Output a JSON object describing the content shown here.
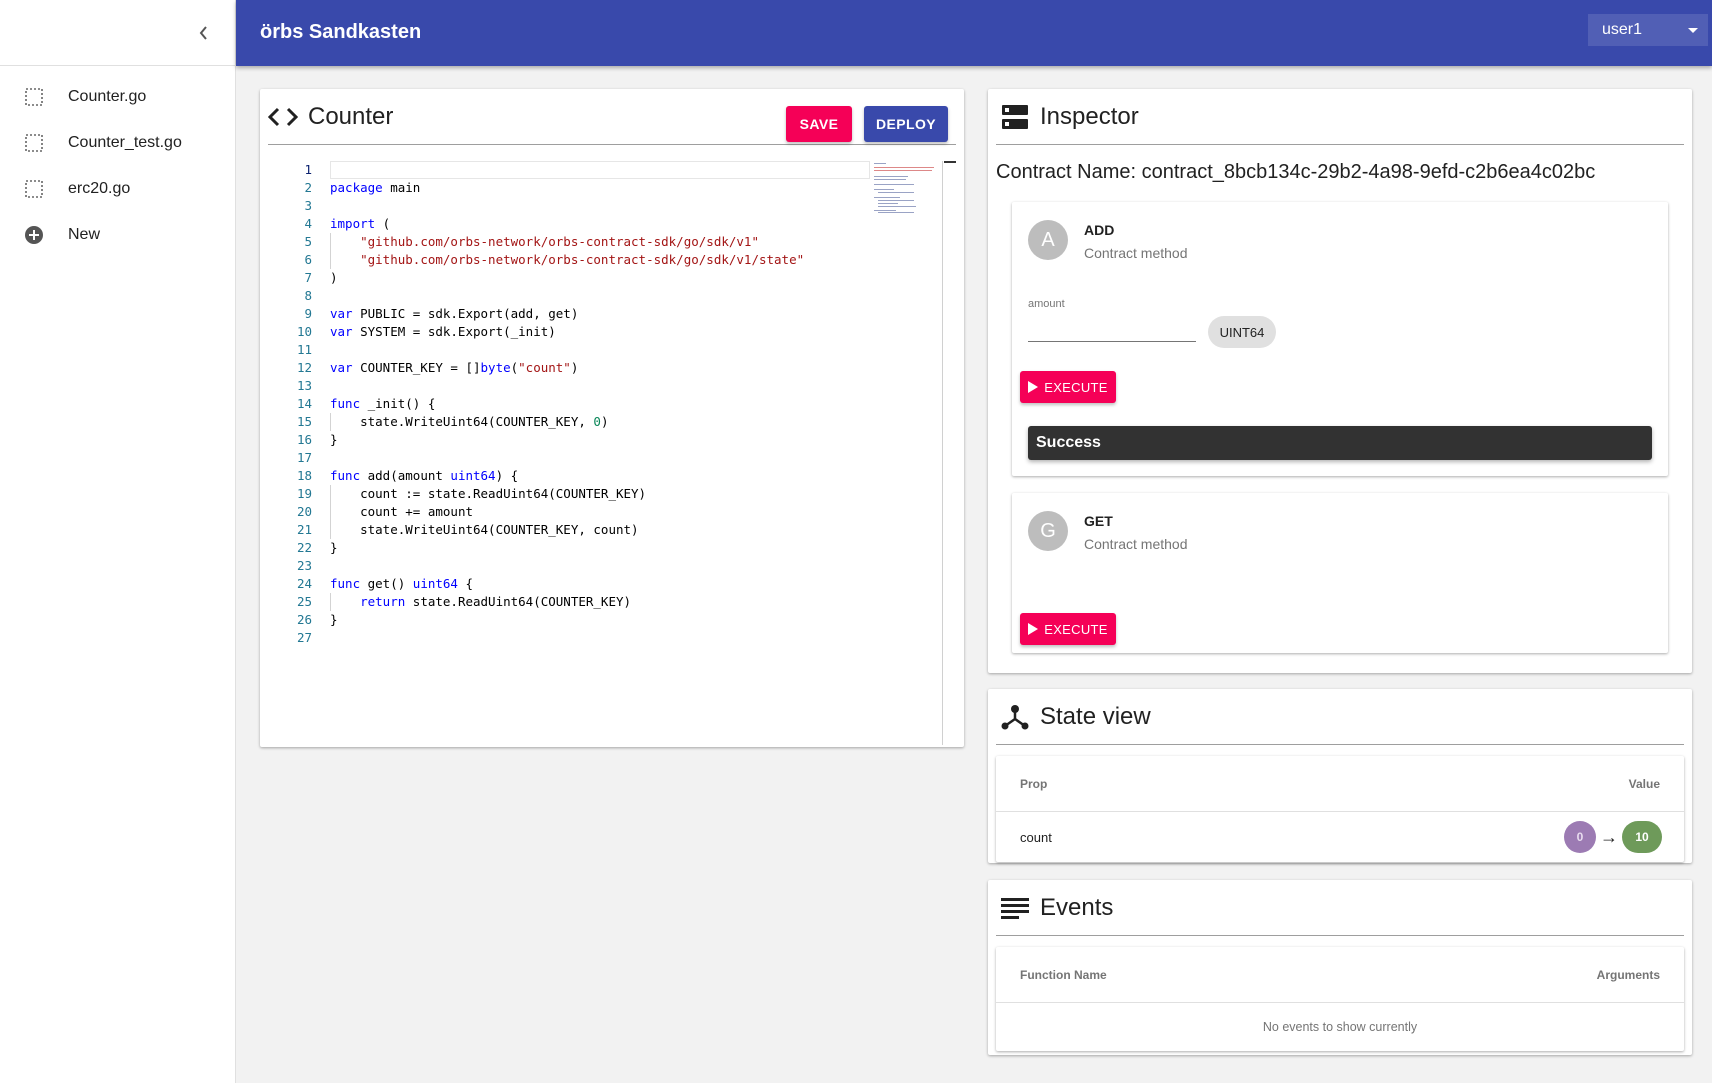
{
  "app": {
    "title": "örbs Sandkasten",
    "user": "user1"
  },
  "sidebar": {
    "items": [
      {
        "label": "Counter.go",
        "icon": "file-icon"
      },
      {
        "label": "Counter_test.go",
        "icon": "file-icon"
      },
      {
        "label": "erc20.go",
        "icon": "file-icon"
      },
      {
        "label": "New",
        "icon": "add-circle-icon"
      }
    ]
  },
  "editor": {
    "title": "Counter",
    "save_label": "SAVE",
    "deploy_label": "DEPLOY",
    "line_numbers": [
      "1",
      "2",
      "3",
      "4",
      "5",
      "6",
      "7",
      "8",
      "9",
      "10",
      "11",
      "12",
      "13",
      "14",
      "15",
      "16",
      "17",
      "18",
      "19",
      "20",
      "21",
      "22",
      "23",
      "24",
      "25",
      "26",
      "27"
    ],
    "code": {
      "l2_kw": "package",
      "l2_rest": " main",
      "l4_kw": "import",
      "l4_rest": " (",
      "l5": "\"github.com/orbs-network/orbs-contract-sdk/go/sdk/v1\"",
      "l6": "\"github.com/orbs-network/orbs-contract-sdk/go/sdk/v1/state\"",
      "l7": ")",
      "l9_kw": "var",
      "l9_rest": " PUBLIC = sdk.Export(add, get)",
      "l10_kw": "var",
      "l10_rest": " SYSTEM = sdk.Export(_init)",
      "l12_kw": "var",
      "l12_rest": " COUNTER_KEY = []",
      "l12_kw2": "byte",
      "l12_p1": "(",
      "l12_str": "\"count\"",
      "l12_p2": ")",
      "l14_kw": "func",
      "l14_rest": " _init() {",
      "l15_a": "state.WriteUint64(COUNTER_KEY, ",
      "l15_num": "0",
      "l15_b": ")",
      "l16": "}",
      "l18_kw": "func",
      "l18_a": " add(amount ",
      "l18_kw2": "uint64",
      "l18_b": ") {",
      "l19": "count := state.ReadUint64(COUNTER_KEY)",
      "l20": "count += amount",
      "l21": "state.WriteUint64(COUNTER_KEY, count)",
      "l22": "}",
      "l24_kw": "func",
      "l24_a": " get() ",
      "l24_kw2": "uint64",
      "l24_b": " {",
      "l25_kw": "return",
      "l25_rest": " state.ReadUint64(COUNTER_KEY)",
      "l26": "}"
    }
  },
  "inspector": {
    "title": "Inspector",
    "contract_name": "Contract Name: contract_8bcb134c-29b2-4a98-9efd-c2b6ea4c02bc",
    "methods": [
      {
        "avatar": "A",
        "name": "ADD",
        "subtitle": "Contract method",
        "arg_label": "amount",
        "arg_value": "",
        "arg_type": "UINT64",
        "execute_label": "EXECUTE",
        "result": "Success"
      },
      {
        "avatar": "G",
        "name": "GET",
        "subtitle": "Contract method",
        "execute_label": "EXECUTE"
      }
    ]
  },
  "state_view": {
    "title": "State view",
    "columns": [
      "Prop",
      "Value"
    ],
    "rows": [
      {
        "prop": "count",
        "old": "0",
        "new": "10",
        "arrow": "→"
      }
    ]
  },
  "events": {
    "title": "Events",
    "columns": [
      "Function Name",
      "Arguments"
    ],
    "empty_text": "No events to show currently"
  },
  "colors": {
    "primary": "#3949ab",
    "accent": "#f50057",
    "old_value": "#9c7bb3",
    "new_value": "#6e9a5a"
  }
}
